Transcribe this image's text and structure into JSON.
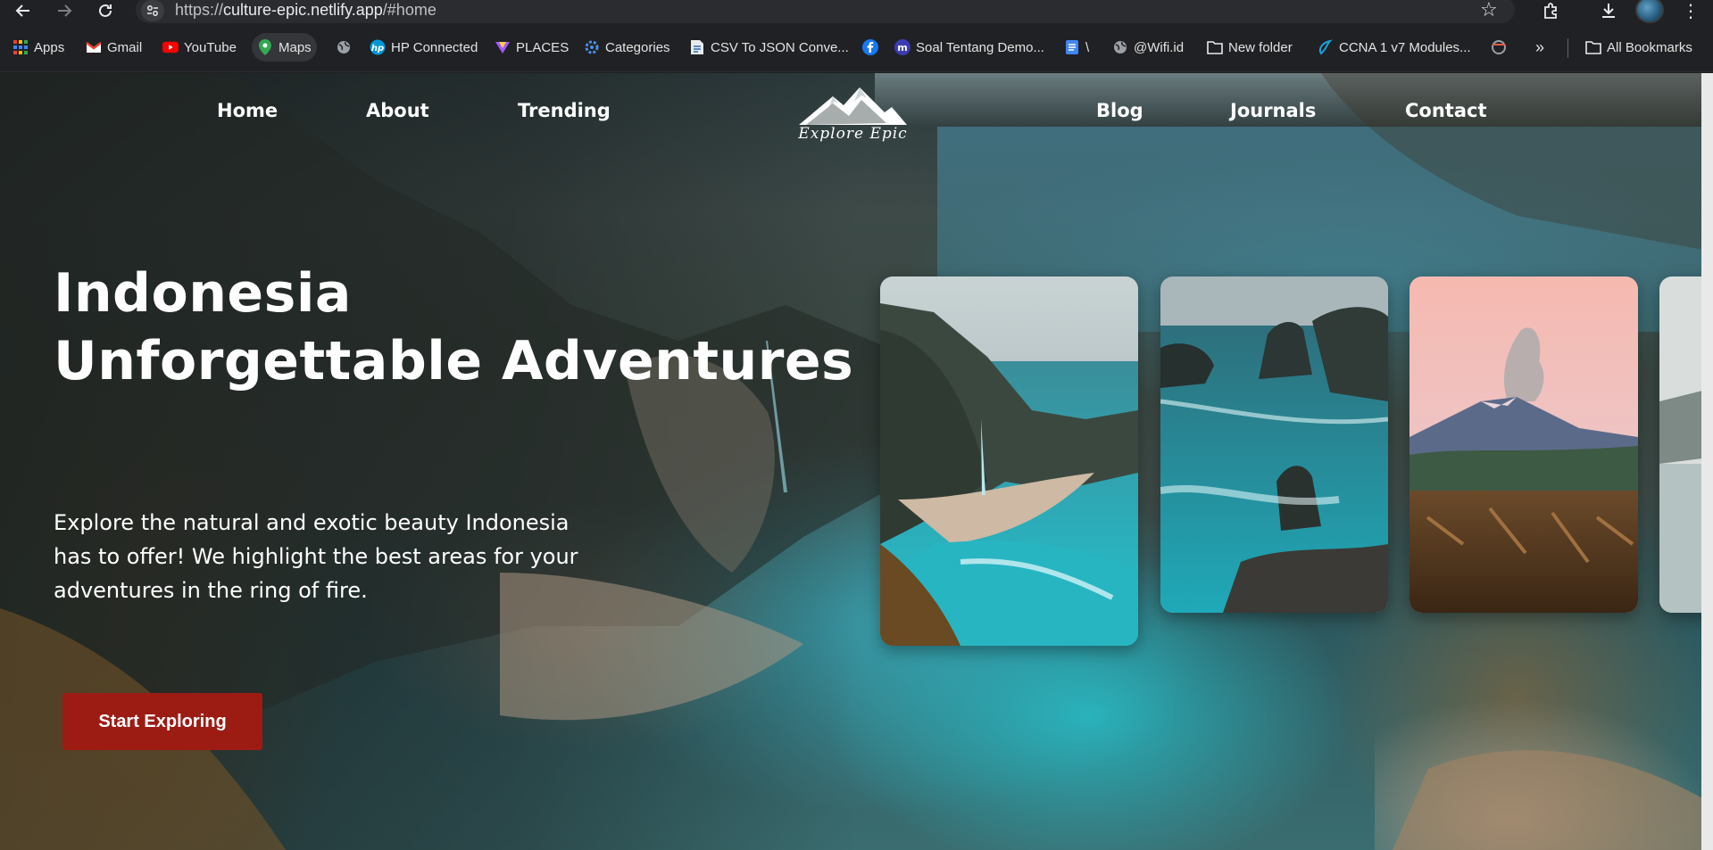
{
  "browser": {
    "url_scheme": "https://",
    "url_host": "culture-epic.netlify.app",
    "url_path": "/#home",
    "bookmarks": [
      {
        "label": "Apps",
        "icon": "apps-grid-icon"
      },
      {
        "label": "Gmail",
        "icon": "gmail-icon"
      },
      {
        "label": "YouTube",
        "icon": "youtube-icon"
      },
      {
        "label": "Maps",
        "icon": "maps-pin-icon"
      },
      {
        "label": "",
        "icon": "globe-icon"
      },
      {
        "label": "HP Connected",
        "icon": "hp-icon"
      },
      {
        "label": "PLACES",
        "icon": "places-icon"
      },
      {
        "label": "Categories",
        "icon": "categories-icon"
      },
      {
        "label": "CSV To JSON Conve...",
        "icon": "document-icon"
      },
      {
        "label": "",
        "icon": "facebook-icon"
      },
      {
        "label": "Soal Tentang Demo...",
        "icon": "m-badge-icon"
      },
      {
        "label": "\\",
        "icon": "docs-icon"
      },
      {
        "label": "@Wifi.id",
        "icon": "globe-icon"
      },
      {
        "label": "New folder",
        "icon": "folder-icon"
      },
      {
        "label": "CCNA 1 v7 Modules...",
        "icon": "ccna-icon"
      },
      {
        "label": "",
        "icon": "extension-icon"
      }
    ],
    "all_bookmarks_label": "All Bookmarks"
  },
  "nav": {
    "left": [
      "Home",
      "About",
      "Trending"
    ],
    "right": [
      "Blog",
      "Journals",
      "Contact"
    ],
    "logo_text": "Explore Epic"
  },
  "hero": {
    "title_line1": "Indonesia",
    "title_line2": "Unforgettable Adventures",
    "description": "Explore the natural and exotic beauty Indonesia has to offer! We highlight the best areas for your adventures in the ring of fire.",
    "cta_label": "Start Exploring"
  },
  "colors": {
    "cta": "#9c1c14",
    "chrome_bg": "#202124",
    "text": "#ffffff"
  },
  "cards": [
    {
      "name": "coastal-cliff-beach"
    },
    {
      "name": "sea-stacks"
    },
    {
      "name": "erupting-volcano"
    },
    {
      "name": "misty-lake"
    }
  ]
}
